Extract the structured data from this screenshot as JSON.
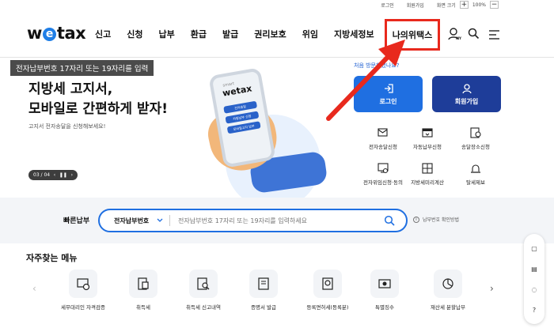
{
  "util": {
    "login": "로그인",
    "join": "회원가입",
    "screen_size": "화면 크기",
    "plus": "+",
    "zoom": "100%",
    "minus": "−"
  },
  "logo": {
    "before": "w",
    "e": "e",
    "after": "tax"
  },
  "nav": [
    "신고",
    "신청",
    "납부",
    "환급",
    "발급",
    "권리보호",
    "위임",
    "지방세정보"
  ],
  "nav_highlight": "나의위택스",
  "header_icons": {
    "my": "MY"
  },
  "hero": {
    "tag": "전자납부번호 17자리 또는 19자리를 입력",
    "title_line1": "지방세 고지서,",
    "title_line2": "모바일로 간편하게 받자!",
    "subtitle": "고지서 전자송달을 신청해보세요!",
    "pager": "03 / 04",
    "phone_brand_small": "smart",
    "phone_brand": "wetax",
    "phone_btn1": "전자송달",
    "phone_btn2": "자동납부 신청",
    "phone_btn3": "모바일고지 납부"
  },
  "cta": {
    "lead": "처음 방문하셨나요?",
    "login": "로그인",
    "join": "회원가입"
  },
  "quick_actions": [
    {
      "label": "전자송달신청",
      "icon": "mail-icon"
    },
    {
      "label": "자동납부신청",
      "icon": "auto-pay-icon"
    },
    {
      "label": "송달장소신청",
      "icon": "location-icon"
    },
    {
      "label": "전자위임신청·동의",
      "icon": "delegate-icon"
    },
    {
      "label": "지방세미리계산",
      "icon": "calculator-icon"
    },
    {
      "label": "탈세제보",
      "icon": "siren-icon"
    }
  ],
  "quick_pay": {
    "label": "빠른납부",
    "select": "전자납부번호",
    "placeholder": "전자납부번호 17자리 또는 19자리를 입력하세요",
    "help": "납부번호 확인방법"
  },
  "favorites": {
    "title": "자주찾는 메뉴",
    "items": [
      {
        "label": "세무대리인 자격검증",
        "icon": "verify-icon"
      },
      {
        "label": "취득세",
        "icon": "acquisition-tax-icon"
      },
      {
        "label": "취득세 신고내역",
        "icon": "report-search-icon"
      },
      {
        "label": "증명서 발급",
        "icon": "certificate-icon"
      },
      {
        "label": "등록면허세(등록분)",
        "icon": "registration-tax-icon"
      },
      {
        "label": "특별징수",
        "icon": "special-collection-icon"
      },
      {
        "label": "재산세 분할납부",
        "icon": "pie-icon"
      }
    ]
  },
  "colors": {
    "primary": "#1f6fe1",
    "navy": "#1e3d99",
    "highlight": "#e8291d"
  }
}
